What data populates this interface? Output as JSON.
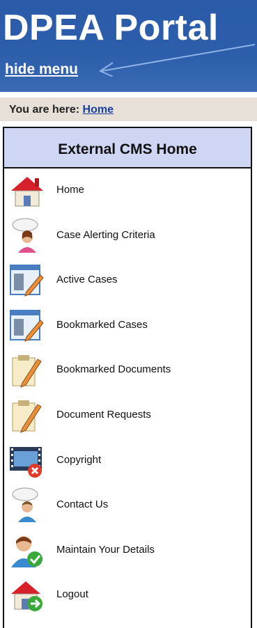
{
  "header": {
    "title": "DPEA Portal",
    "hide_menu_label": "hide menu"
  },
  "breadcrumb": {
    "prefix": "You are here:",
    "home_link": "Home"
  },
  "panel": {
    "title": "External CMS Home"
  },
  "menu": [
    {
      "label": "Home",
      "icon": "house-icon"
    },
    {
      "label": "Case Alerting Criteria",
      "icon": "speech-person-icon"
    },
    {
      "label": "Active Cases",
      "icon": "document-pencil-icon"
    },
    {
      "label": "Bookmarked Cases",
      "icon": "document-pencil-icon"
    },
    {
      "label": "Bookmarked Documents",
      "icon": "clipboard-pencil-icon"
    },
    {
      "label": "Document Requests",
      "icon": "clipboard-pencil-icon"
    },
    {
      "label": "Copyright",
      "icon": "film-x-icon"
    },
    {
      "label": "Contact Us",
      "icon": "speech-person-icon"
    },
    {
      "label": "Maintain Your Details",
      "icon": "user-check-icon"
    },
    {
      "label": "Logout",
      "icon": "house-exit-icon"
    }
  ],
  "colors": {
    "header": "#2d5eab",
    "breadcrumb_bg": "#e6e0d8",
    "panel_head_bg": "#cfd6f4",
    "link": "#1a3fa0"
  }
}
